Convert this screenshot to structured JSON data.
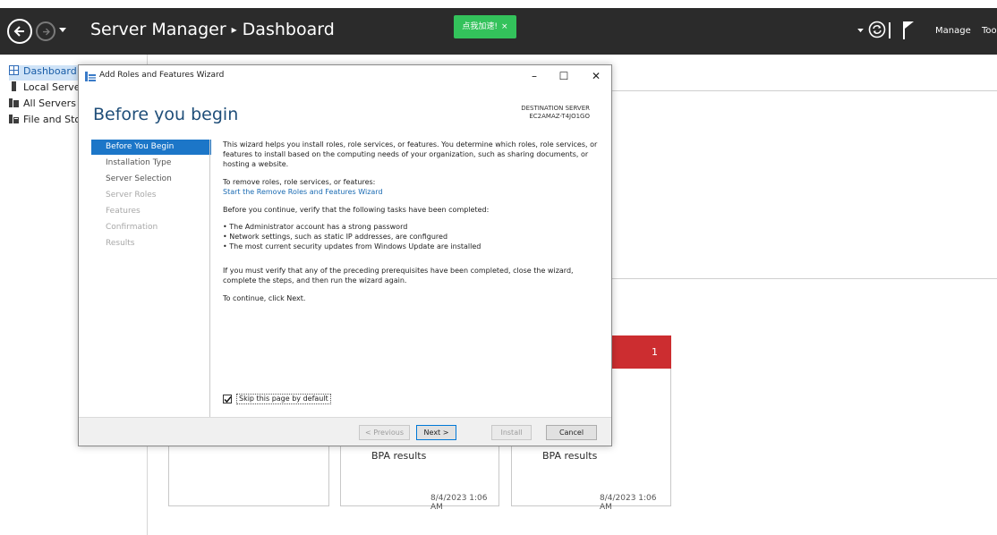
{
  "header": {
    "app_title": "Server Manager",
    "separator": "▸",
    "page_title": "Dashboard",
    "notification_chip": "点我加速!",
    "notification_close": "×",
    "menu_manage": "Manage",
    "menu_tools": "Tool"
  },
  "sidebar": {
    "items": [
      {
        "label": "Dashboard",
        "icon": "dashboard-icon",
        "active": true
      },
      {
        "label": "Local Server",
        "icon": "server-icon"
      },
      {
        "label": "All Servers",
        "icon": "servers-icon"
      },
      {
        "label": "File and Storage Services",
        "icon": "file-storage-icon"
      }
    ]
  },
  "dashboard": {
    "red_tile_count": "1",
    "tiles": [
      {
        "label": "BPA results",
        "date": "8/4/2023 1:06 AM"
      },
      {
        "label": "BPA results",
        "date": "8/4/2023 1:06 AM"
      }
    ]
  },
  "wizard": {
    "window_title": "Add Roles and Features Wizard",
    "window_controls": {
      "minimize": "–",
      "maximize": "☐",
      "close": "✕"
    },
    "heading": "Before you begin",
    "destination_label": "DESTINATION SERVER",
    "destination_server": "EC2AMAZ-T4JO1GO",
    "steps": [
      {
        "label": "Before You Begin",
        "state": "active"
      },
      {
        "label": "Installation Type",
        "state": "enabled"
      },
      {
        "label": "Server Selection",
        "state": "enabled"
      },
      {
        "label": "Server Roles",
        "state": "disabled"
      },
      {
        "label": "Features",
        "state": "disabled"
      },
      {
        "label": "Confirmation",
        "state": "disabled"
      },
      {
        "label": "Results",
        "state": "disabled"
      }
    ],
    "intro_line1": "This wizard helps you install roles, role services, or features. You determine which roles, role services, or",
    "intro_line2": "features to install based on the computing needs of your organization, such as sharing documents, or",
    "intro_line3": "hosting a website.",
    "remove_label": "To remove roles, role services, or features:",
    "remove_link": "Start the Remove Roles and Features Wizard",
    "verify_intro": "Before you continue, verify that the following tasks have been completed:",
    "bullets": [
      "The Administrator account has a strong password",
      "Network settings, such as static IP addresses, are configured",
      "The most current security updates from Windows Update are installed"
    ],
    "verify_note_line1": "If you must verify that any of the preceding prerequisites have been completed, close the wizard,",
    "verify_note_line2": "complete the steps, and then run the wizard again.",
    "continue_text": "To continue, click Next.",
    "skip_checkbox_label": "Skip this page by default",
    "skip_checkbox_checked": true,
    "buttons": {
      "previous": "< Previous",
      "next": "Next >",
      "install": "Install",
      "cancel": "Cancel"
    }
  }
}
